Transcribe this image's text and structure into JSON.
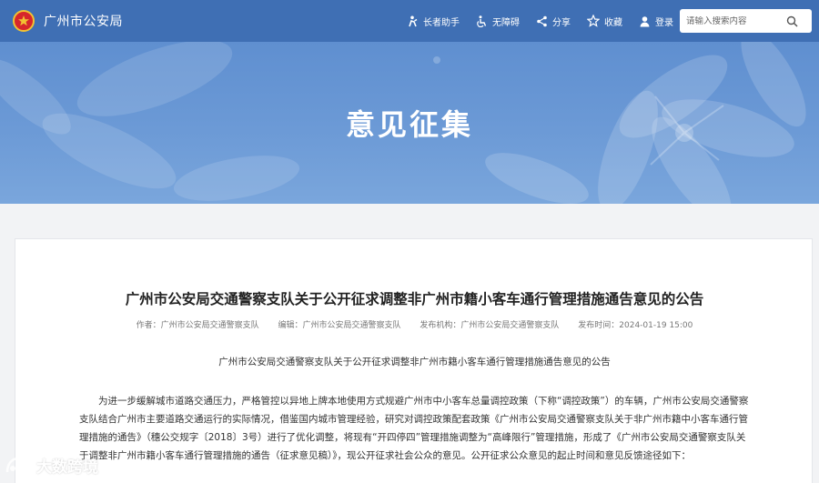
{
  "header": {
    "site_title": "广州市公安局",
    "tools": [
      {
        "label": "长者助手",
        "icon": "elder-assist-icon"
      },
      {
        "label": "无障碍",
        "icon": "accessibility-icon"
      },
      {
        "label": "分享",
        "icon": "share-icon"
      },
      {
        "label": "收藏",
        "icon": "star-icon"
      },
      {
        "label": "登录",
        "icon": "user-icon"
      }
    ],
    "search": {
      "placeholder": "请输入搜索内容",
      "value": ""
    }
  },
  "banner": {
    "title": "意见征集"
  },
  "article": {
    "title": "广州市公安局交通警察支队关于公开征求调整非广州市籍小客车通行管理措施通告意见的公告",
    "meta": {
      "author": "作者：广州市公安局交通警察支队",
      "editor": "编辑：广州市公安局交通警察支队",
      "publisher": "发布机构：广州市公安局交通警察支队",
      "time": "发布时间：2024-01-19 15:00"
    },
    "subtitle": "广州市公安局交通警察支队关于公开征求调整非广州市籍小客车通行管理措施通告意见的公告",
    "paragraph": "为进一步缓解城市道路交通压力，严格管控以异地上牌本地使用方式规避广州市中小客车总量调控政策（下称“调控政策”）的车辆，广州市公安局交通警察支队结合广州市主要道路交通运行的实际情况，借鉴国内城市管理经验，研究对调控政策配套政策《广州市公安局交通警察支队关于非广州市籍中小客车通行管理措施的通告》（穗公交规字〔2018〕3号）进行了优化调整，将现有“开四停四”管理措施调整为“高峰限行”管理措施，形成了《广州市公安局交通警察支队关于调整非广州市籍小客车通行管理措施的通告（征求意见稿）》，现公开征求社会公众的意见。公开征求公众意见的起止时间和意见反馈途径如下："
  },
  "watermark": {
    "text": "大数跨境"
  },
  "colors": {
    "header": "#3f6fb4",
    "banner": "#6c9ad6",
    "emblem": "#d7262b"
  }
}
